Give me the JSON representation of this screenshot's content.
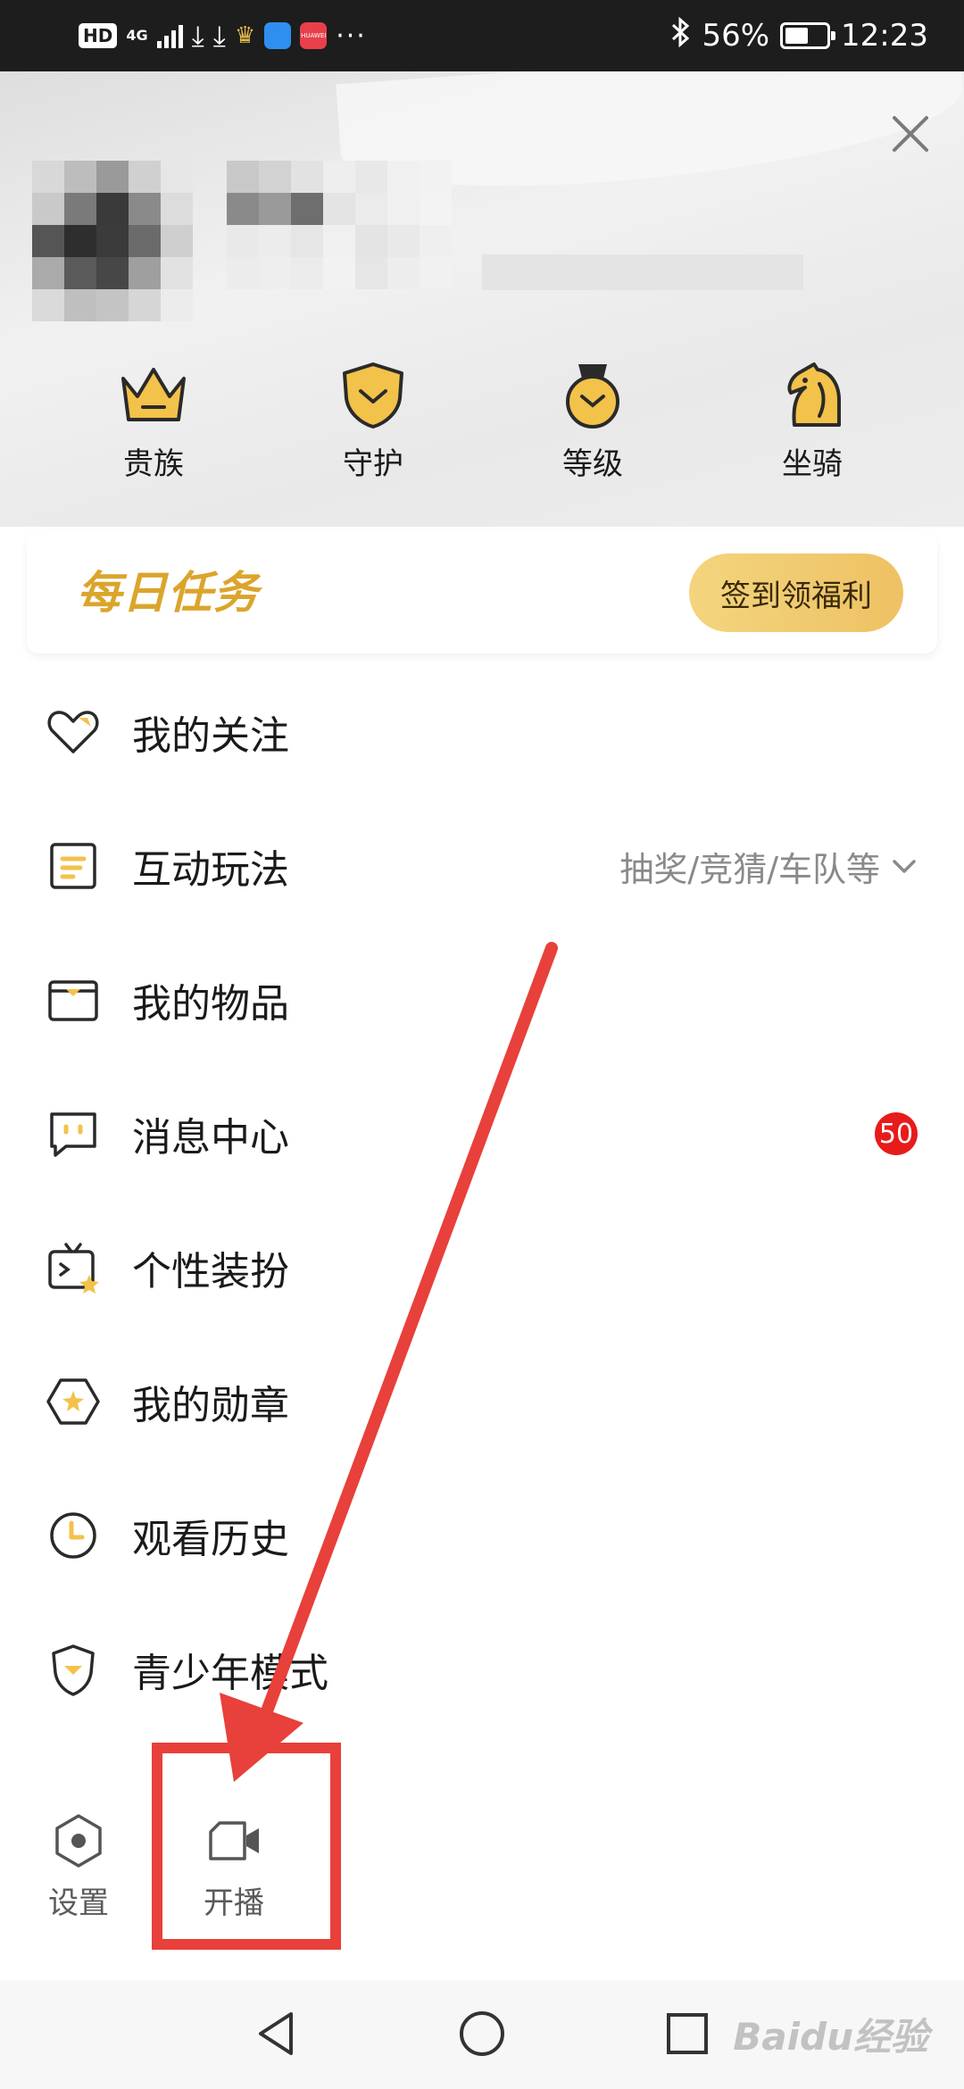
{
  "status_bar": {
    "hd": "HD",
    "network": "4G",
    "battery": "56%",
    "battery_level": 0.56,
    "time": "12:23",
    "app_icon_label": "HUAWEI",
    "more": "···"
  },
  "header": {
    "close_icon": "close-icon",
    "perks": [
      {
        "label": "贵族",
        "icon": "crown-icon"
      },
      {
        "label": "守护",
        "icon": "shield-icon"
      },
      {
        "label": "等级",
        "icon": "medal-icon"
      },
      {
        "label": "坐骑",
        "icon": "horse-icon"
      }
    ]
  },
  "daily_task": {
    "title": "每日任务",
    "button": "签到领福利"
  },
  "menu": [
    {
      "label": "我的关注",
      "icon": "heart-icon"
    },
    {
      "label": "互动玩法",
      "icon": "interaction-icon",
      "right": "抽奖/竞猜/车队等"
    },
    {
      "label": "我的物品",
      "icon": "box-icon"
    },
    {
      "label": "消息中心",
      "icon": "message-icon",
      "badge": "50"
    },
    {
      "label": "个性装扮",
      "icon": "dressup-icon"
    },
    {
      "label": "我的勋章",
      "icon": "badge-icon"
    },
    {
      "label": "观看历史",
      "icon": "history-icon"
    },
    {
      "label": "青少年模式",
      "icon": "teen-shield-icon"
    }
  ],
  "bottom": {
    "settings": "设置",
    "broadcast": "开播"
  },
  "watermark": "Baidu经验",
  "colors": {
    "accent": "#dba52c",
    "badge": "#e81b1b",
    "annotation": "#e8403a"
  }
}
